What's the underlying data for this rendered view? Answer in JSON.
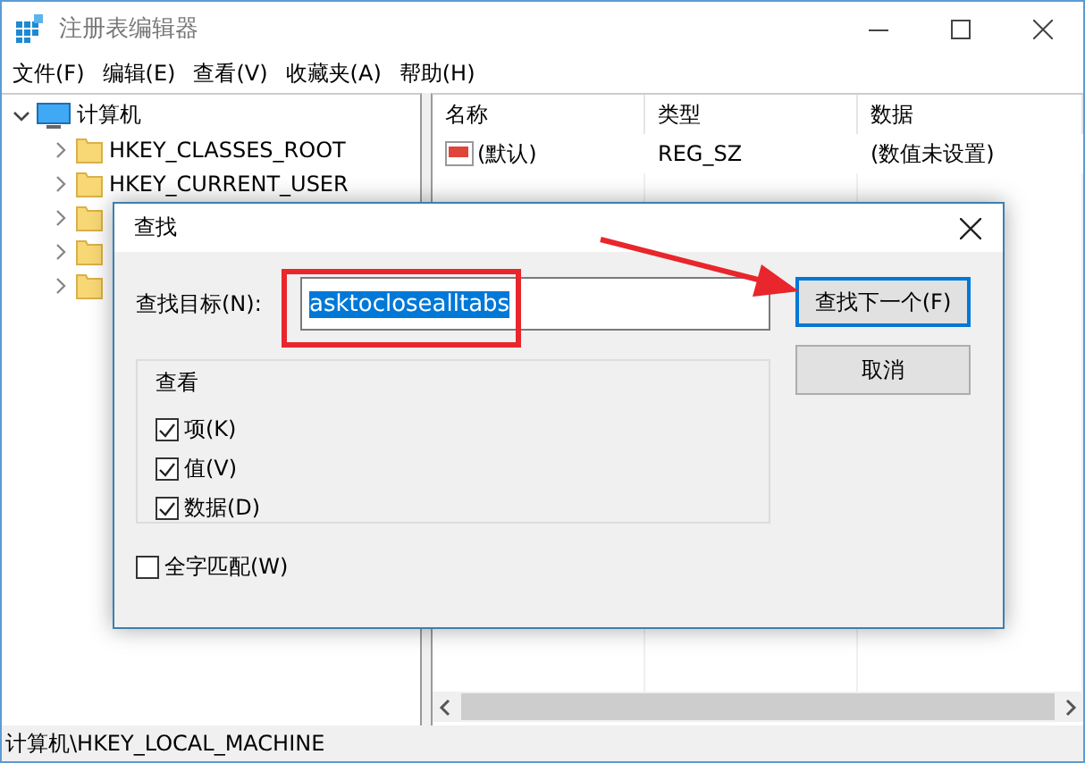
{
  "window": {
    "title": "注册表编辑器"
  },
  "menu": [
    "文件(F)",
    "编辑(E)",
    "查看(V)",
    "收藏夹(A)",
    "帮助(H)"
  ],
  "tree": [
    {
      "label": "计算机",
      "expanded": true,
      "children": [
        {
          "label": "HKEY_CLASSES_ROOT",
          "expanded": false
        },
        {
          "label": "HKEY_CURRENT_USER",
          "expanded": false
        },
        {
          "expanded": false
        },
        {
          "expanded": false
        },
        {
          "expanded": false
        }
      ]
    }
  ],
  "columns": [
    "名称",
    "类型",
    "数据"
  ],
  "rows": [
    {
      "name": "(默认)",
      "type": "REG_SZ",
      "data": "(数值未设置)"
    }
  ],
  "status_bar": "计算机\\HKEY_LOCAL_MACHINE",
  "dialog": {
    "title": "查找",
    "find_label": "查找目标(N):",
    "find_value": "asktoclosealltabs",
    "value_selected": true,
    "buttons": [
      {
        "label": "查找下一个(F)",
        "default": true
      },
      {
        "label": "取消",
        "default": false
      }
    ],
    "group": "查看",
    "options": [
      {
        "label": "项(K)",
        "checked": true
      },
      {
        "label": "值(V)",
        "checked": true
      },
      {
        "label": "数据(D)",
        "checked": true
      }
    ],
    "whole_word": {
      "label": "全字匹配(W)",
      "checked": false
    }
  }
}
